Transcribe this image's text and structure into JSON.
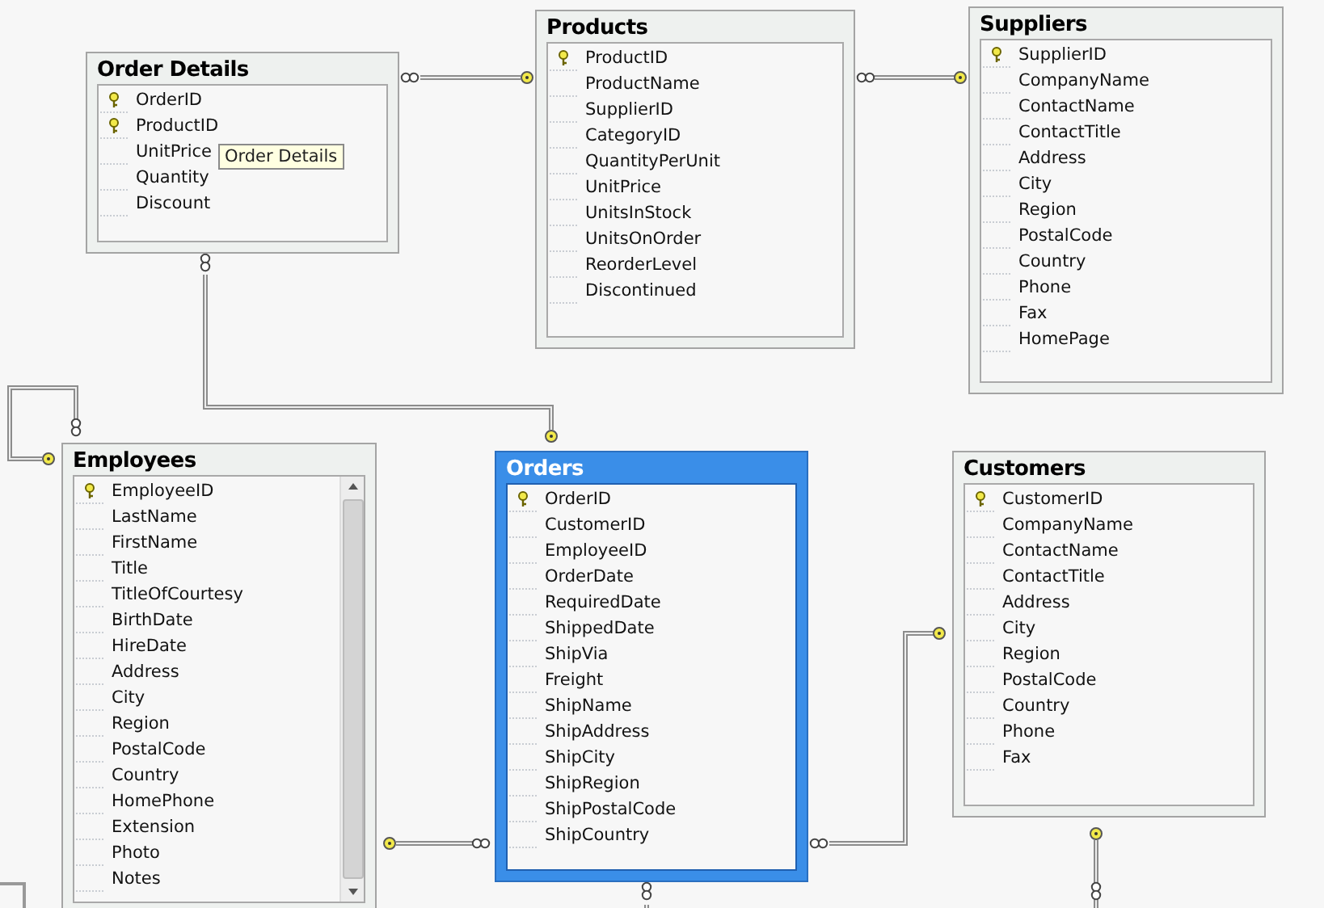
{
  "tables": [
    {
      "name": "Order Details",
      "selected": false,
      "scrollbar": false,
      "columns": [
        {
          "name": "OrderID",
          "primary_key": true
        },
        {
          "name": "ProductID",
          "primary_key": true
        },
        {
          "name": "UnitPrice",
          "primary_key": false
        },
        {
          "name": "Quantity",
          "primary_key": false
        },
        {
          "name": "Discount",
          "primary_key": false
        }
      ]
    },
    {
      "name": "Products",
      "selected": false,
      "scrollbar": false,
      "columns": [
        {
          "name": "ProductID",
          "primary_key": true
        },
        {
          "name": "ProductName",
          "primary_key": false
        },
        {
          "name": "SupplierID",
          "primary_key": false
        },
        {
          "name": "CategoryID",
          "primary_key": false
        },
        {
          "name": "QuantityPerUnit",
          "primary_key": false
        },
        {
          "name": "UnitPrice",
          "primary_key": false
        },
        {
          "name": "UnitsInStock",
          "primary_key": false
        },
        {
          "name": "UnitsOnOrder",
          "primary_key": false
        },
        {
          "name": "ReorderLevel",
          "primary_key": false
        },
        {
          "name": "Discontinued",
          "primary_key": false
        }
      ]
    },
    {
      "name": "Suppliers",
      "selected": false,
      "scrollbar": false,
      "columns": [
        {
          "name": "SupplierID",
          "primary_key": true
        },
        {
          "name": "CompanyName",
          "primary_key": false
        },
        {
          "name": "ContactName",
          "primary_key": false
        },
        {
          "name": "ContactTitle",
          "primary_key": false
        },
        {
          "name": "Address",
          "primary_key": false
        },
        {
          "name": "City",
          "primary_key": false
        },
        {
          "name": "Region",
          "primary_key": false
        },
        {
          "name": "PostalCode",
          "primary_key": false
        },
        {
          "name": "Country",
          "primary_key": false
        },
        {
          "name": "Phone",
          "primary_key": false
        },
        {
          "name": "Fax",
          "primary_key": false
        },
        {
          "name": "HomePage",
          "primary_key": false
        }
      ]
    },
    {
      "name": "Employees",
      "selected": false,
      "scrollbar": true,
      "columns": [
        {
          "name": "EmployeeID",
          "primary_key": true
        },
        {
          "name": "LastName",
          "primary_key": false
        },
        {
          "name": "FirstName",
          "primary_key": false
        },
        {
          "name": "Title",
          "primary_key": false
        },
        {
          "name": "TitleOfCourtesy",
          "primary_key": false
        },
        {
          "name": "BirthDate",
          "primary_key": false
        },
        {
          "name": "HireDate",
          "primary_key": false
        },
        {
          "name": "Address",
          "primary_key": false
        },
        {
          "name": "City",
          "primary_key": false
        },
        {
          "name": "Region",
          "primary_key": false
        },
        {
          "name": "PostalCode",
          "primary_key": false
        },
        {
          "name": "Country",
          "primary_key": false
        },
        {
          "name": "HomePhone",
          "primary_key": false
        },
        {
          "name": "Extension",
          "primary_key": false
        },
        {
          "name": "Photo",
          "primary_key": false
        },
        {
          "name": "Notes",
          "primary_key": false
        }
      ]
    },
    {
      "name": "Orders",
      "selected": true,
      "scrollbar": false,
      "columns": [
        {
          "name": "OrderID",
          "primary_key": true
        },
        {
          "name": "CustomerID",
          "primary_key": false
        },
        {
          "name": "EmployeeID",
          "primary_key": false
        },
        {
          "name": "OrderDate",
          "primary_key": false
        },
        {
          "name": "RequiredDate",
          "primary_key": false
        },
        {
          "name": "ShippedDate",
          "primary_key": false
        },
        {
          "name": "ShipVia",
          "primary_key": false
        },
        {
          "name": "Freight",
          "primary_key": false
        },
        {
          "name": "ShipName",
          "primary_key": false
        },
        {
          "name": "ShipAddress",
          "primary_key": false
        },
        {
          "name": "ShipCity",
          "primary_key": false
        },
        {
          "name": "ShipRegion",
          "primary_key": false
        },
        {
          "name": "ShipPostalCode",
          "primary_key": false
        },
        {
          "name": "ShipCountry",
          "primary_key": false
        }
      ]
    },
    {
      "name": "Customers",
      "selected": false,
      "scrollbar": false,
      "columns": [
        {
          "name": "CustomerID",
          "primary_key": true
        },
        {
          "name": "CompanyName",
          "primary_key": false
        },
        {
          "name": "ContactName",
          "primary_key": false
        },
        {
          "name": "ContactTitle",
          "primary_key": false
        },
        {
          "name": "Address",
          "primary_key": false
        },
        {
          "name": "City",
          "primary_key": false
        },
        {
          "name": "Region",
          "primary_key": false
        },
        {
          "name": "PostalCode",
          "primary_key": false
        },
        {
          "name": "Country",
          "primary_key": false
        },
        {
          "name": "Phone",
          "primary_key": false
        },
        {
          "name": "Fax",
          "primary_key": false
        }
      ]
    }
  ],
  "tooltip": "Order Details"
}
